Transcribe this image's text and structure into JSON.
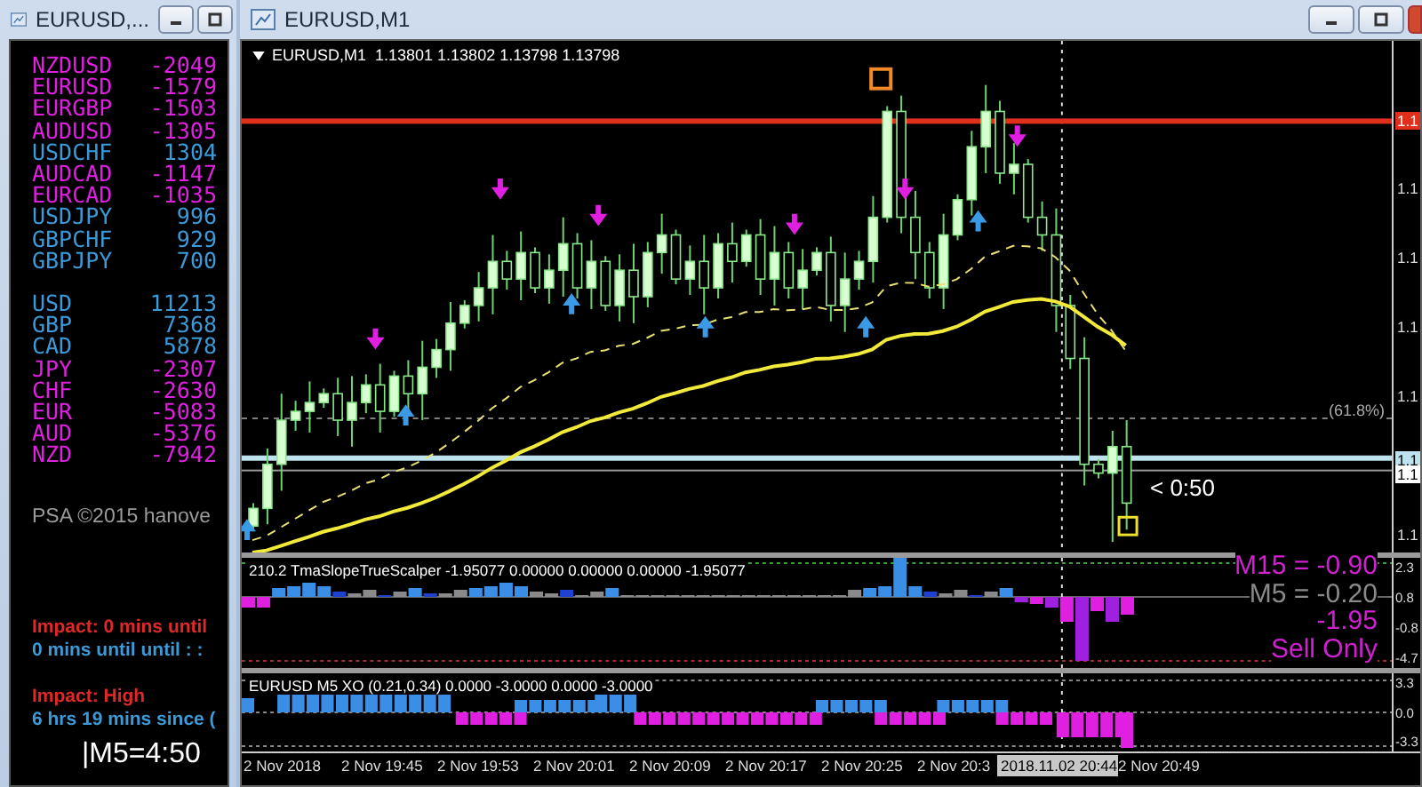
{
  "left_window": {
    "title": "EURUSD,...",
    "pairs": [
      {
        "name": "NZDUSD",
        "value": "-2049",
        "color": "#e020e0"
      },
      {
        "name": "EURUSD",
        "value": "-1579",
        "color": "#e020e0"
      },
      {
        "name": "EURGBP",
        "value": "-1503",
        "color": "#e020e0"
      },
      {
        "name": "AUDUSD",
        "value": "-1305",
        "color": "#e020e0"
      },
      {
        "name": "USDCHF",
        "value": "1304",
        "color": "#3c9ad8"
      },
      {
        "name": "AUDCAD",
        "value": "-1147",
        "color": "#e020e0"
      },
      {
        "name": "EURCAD",
        "value": "-1035",
        "color": "#e020e0"
      },
      {
        "name": "USDJPY",
        "value": "996",
        "color": "#3c9ad8"
      },
      {
        "name": "GBPCHF",
        "value": "929",
        "color": "#3c9ad8"
      },
      {
        "name": "GBPJPY",
        "value": "700",
        "color": "#3c9ad8"
      }
    ],
    "currencies": [
      {
        "name": "USD",
        "value": "11213",
        "color": "#3c9ad8"
      },
      {
        "name": "GBP",
        "value": "7368",
        "color": "#3c9ad8"
      },
      {
        "name": "CAD",
        "value": "5878",
        "color": "#3c9ad8"
      },
      {
        "name": "JPY",
        "value": "-2307",
        "color": "#e020e0"
      },
      {
        "name": "CHF",
        "value": "-2630",
        "color": "#e020e0"
      },
      {
        "name": "EUR",
        "value": "-5083",
        "color": "#e020e0"
      },
      {
        "name": "AUD",
        "value": "-5376",
        "color": "#e020e0"
      },
      {
        "name": "NZD",
        "value": "-7942",
        "color": "#e020e0"
      }
    ],
    "copyright": "PSA ©2015 hanove",
    "news": [
      {
        "lines": [
          {
            "text": "Impact: 0 mins until",
            "color": "#e02828"
          },
          {
            "text": "0 mins until until : :",
            "color": "#3c9ad8"
          }
        ]
      },
      {
        "lines": [
          {
            "text": "Impact: High",
            "color": "#e02828"
          },
          {
            "text": "6 hrs 19 mins since (",
            "color": "#3c9ad8"
          }
        ]
      }
    ],
    "timer": "|M5=4:50"
  },
  "chart_window": {
    "title": "EURUSD,M1",
    "symbol_header": "EURUSD,M1  1.13801 1.13802 1.13798 1.13798",
    "fib_label": "(61.8%)",
    "countdown": "< 0:50",
    "price_axis": [
      {
        "label": "1.1",
        "kind": "resistance"
      },
      {
        "label": "1.1",
        "kind": "tick"
      },
      {
        "label": "1.1",
        "kind": "tick"
      },
      {
        "label": "1.1",
        "kind": "tick"
      },
      {
        "label": "1.1",
        "kind": "tick"
      },
      {
        "label": "1.1",
        "kind": "ask"
      },
      {
        "label": "1.1",
        "kind": "bid"
      },
      {
        "label": "1.1",
        "kind": "tick"
      }
    ],
    "oscillator": {
      "title": "210.2 TmaSlopeTrueScalper -1.95077 0.00000 0.00000 0.00000 -1.95077",
      "axis": [
        "2.3",
        "0.8",
        "-0.8",
        "-4.7"
      ],
      "readings": [
        {
          "text": "M15 = -0.90",
          "color": "#d020d0"
        },
        {
          "text": "M5 = -0.20",
          "color": "#8a8a8a"
        },
        {
          "text": "-1.95",
          "color": "#d020d0"
        },
        {
          "text": "Sell Only",
          "color": "#d020d0"
        }
      ]
    },
    "xo": {
      "title": "EURUSD M5 XO (0.21,0.34) 0.0000 -3.0000 0.0000 -3.0000",
      "axis": [
        "3.3",
        "0.0",
        "-3.3"
      ]
    },
    "time_axis": [
      {
        "label": "2 Nov 2018",
        "highlighted": false
      },
      {
        "label": "2 Nov 19:45",
        "highlighted": false
      },
      {
        "label": "2 Nov 19:53",
        "highlighted": false
      },
      {
        "label": "2 Nov 20:01",
        "highlighted": false
      },
      {
        "label": "2 Nov 20:09",
        "highlighted": false
      },
      {
        "label": "2 Nov 20:17",
        "highlighted": false
      },
      {
        "label": "2 Nov 20:25",
        "highlighted": false
      },
      {
        "label": "2 Nov 20:3",
        "highlighted": false
      },
      {
        "label": "2018.11.02 20:44",
        "highlighted": true
      },
      {
        "label": "2 Nov 20:49",
        "highlighted": false
      }
    ]
  }
}
